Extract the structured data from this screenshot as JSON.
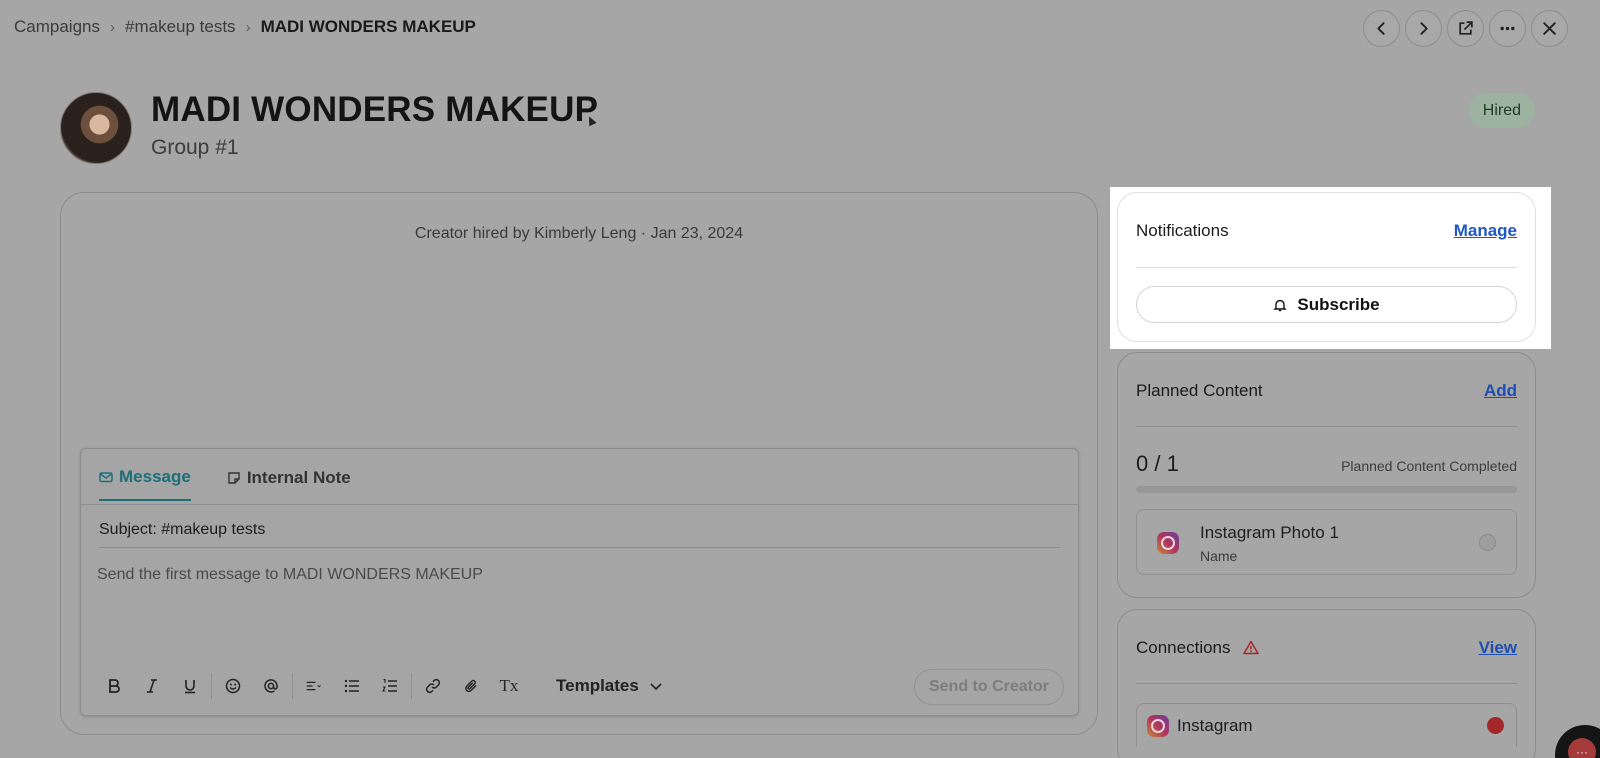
{
  "breadcrumb": {
    "items": [
      "Campaigns",
      "#makeup tests"
    ],
    "current": "MADI WONDERS MAKEUP",
    "separator": "›"
  },
  "top_actions": [
    "chevron-left-icon",
    "chevron-right-icon",
    "external-link-icon",
    "more-icon",
    "close-icon"
  ],
  "header": {
    "title": "MADI WONDERS MAKEUP",
    "subtitle": "Group #1",
    "status": "Hired",
    "status_color": "#9db3a0"
  },
  "activity": {
    "hired_note": "Creator hired by Kimberly Leng  · Jan 23, 2024"
  },
  "composer": {
    "tabs": [
      {
        "label": "Message",
        "icon": "mail-icon",
        "active": true
      },
      {
        "label": "Internal Note",
        "icon": "note-icon",
        "active": false
      }
    ],
    "subject": "Subject: #makeup tests",
    "placeholder": "Send the first message to MADI WONDERS MAKEUP",
    "templates_label": "Templates",
    "send_label": "Send to Creator",
    "clear_format_glyph": "Tx",
    "accent_color": "#1c6f78"
  },
  "notifications": {
    "title": "Notifications",
    "manage_label": "Manage",
    "subscribe_label": "Subscribe"
  },
  "planned_content": {
    "title": "Planned Content",
    "add_label": "Add",
    "count": "0 / 1",
    "completed_label": "Planned Content Completed",
    "progress_fraction": 0,
    "items": [
      {
        "title": "Instagram Photo 1",
        "subtitle": "Name",
        "icon": "instagram-icon"
      }
    ]
  },
  "connections": {
    "title": "Connections",
    "view_label": "View",
    "items": [
      {
        "label": "Instagram",
        "icon": "instagram-icon",
        "status_color": "#a5262b"
      }
    ]
  },
  "chat_fab_glyph": "···"
}
